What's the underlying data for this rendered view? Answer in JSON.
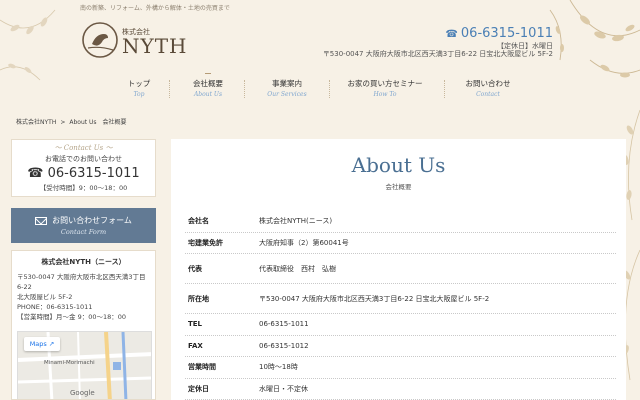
{
  "header": {
    "tagline": "南の新築、リフォーム、外構から解体・土地の売買まで",
    "logo_sub": "株式会社",
    "logo_name": "NYTH",
    "phone": "06-6315-1011",
    "hours": "【定休日】水曜日",
    "address": "〒530-0047 大阪府大阪市北区西天満3丁目6-22 日宝北大阪屋ビル 5F-2"
  },
  "nav": [
    {
      "ja": "トップ",
      "en": "Top"
    },
    {
      "ja": "会社概要",
      "en": "About Us"
    },
    {
      "ja": "事業案内",
      "en": "Our Services"
    },
    {
      "ja": "お家の買い方セミナー",
      "en": "How To"
    },
    {
      "ja": "お問い合わせ",
      "en": "Contact"
    }
  ],
  "breadcrumb": {
    "home": "株式会社NYTH",
    "sep": ">",
    "current": "About Us　会社概要"
  },
  "sidebar": {
    "contact_en": "～ Contact Us ～",
    "contact_ja": "お電話でのお問い合わせ",
    "contact_tel": "06-6315-1011",
    "contact_hours": "【受付時間】9：00～18：00",
    "mail_label": "お問い合わせフォーム",
    "mail_en": "Contact Form",
    "company_name": "株式会社NYTH（ニース）",
    "company_addr": "〒530-0047 大阪府大阪市北区西天満3丁目6-22",
    "company_addr2": "北大阪屋ビル 5F-2",
    "company_phone": "PHONE：06-6315-1011",
    "company_hours": "【営業時間】月～金 9：00～18：00",
    "map_button": "Maps",
    "map_street1": "Minami-Morimachi",
    "map_google": "Google"
  },
  "main": {
    "title": "About Us",
    "subtitle": "会社概要",
    "rows": [
      {
        "k": "会社名",
        "v": "株式会社NYTH(ニース)"
      },
      {
        "k": "宅建業免許",
        "v": "大阪府知事（2）第60041号"
      },
      {
        "k": "代表",
        "v": "代表取締役　西村　弘樹"
      },
      {
        "k": "所在地",
        "v": "〒530-0047 大阪府大阪市北区西天満3丁目6-22 日宝北大阪屋ビル 5F-2"
      },
      {
        "k": "TEL",
        "v": "06-6315-1011"
      },
      {
        "k": "FAX",
        "v": "06-6315-1012"
      },
      {
        "k": "営業時間",
        "v": "10時〜18時"
      },
      {
        "k": "定休日",
        "v": "水曜日・不定休"
      }
    ]
  },
  "colors": {
    "background": "#f7f1e6",
    "accent_blue": "#4a7fb5",
    "title_blue": "#4a6f92",
    "button": "#627a94",
    "brown": "#5a4a38"
  }
}
